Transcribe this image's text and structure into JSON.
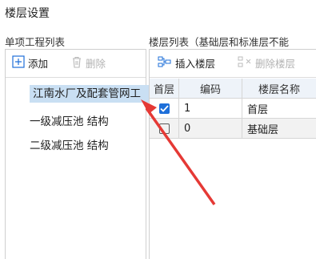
{
  "dialog": {
    "title": "楼层设置"
  },
  "left": {
    "header": "单项工程列表",
    "toolbar": {
      "add_label": "添加",
      "delete_label": "删除"
    },
    "tree": [
      {
        "label": "江南水厂及配套管网工",
        "selected": true
      },
      {
        "label": "一级减压池 结构",
        "selected": false
      },
      {
        "label": "二级减压池 结构",
        "selected": false
      }
    ]
  },
  "right": {
    "header": "楼层列表（基础层和标准层不能",
    "toolbar": {
      "insert_label": "插入楼层",
      "delete_label": "删除楼层"
    },
    "columns": [
      "首层",
      "编码",
      "楼层名称"
    ],
    "rows": [
      {
        "checked": true,
        "code": "1",
        "name": "首层"
      },
      {
        "checked": false,
        "code": "0",
        "name": "基础层"
      }
    ]
  },
  "colors": {
    "accent": "#1e6fd9",
    "selection": "#c9dff3",
    "annotation_arrow": "#e53935"
  }
}
